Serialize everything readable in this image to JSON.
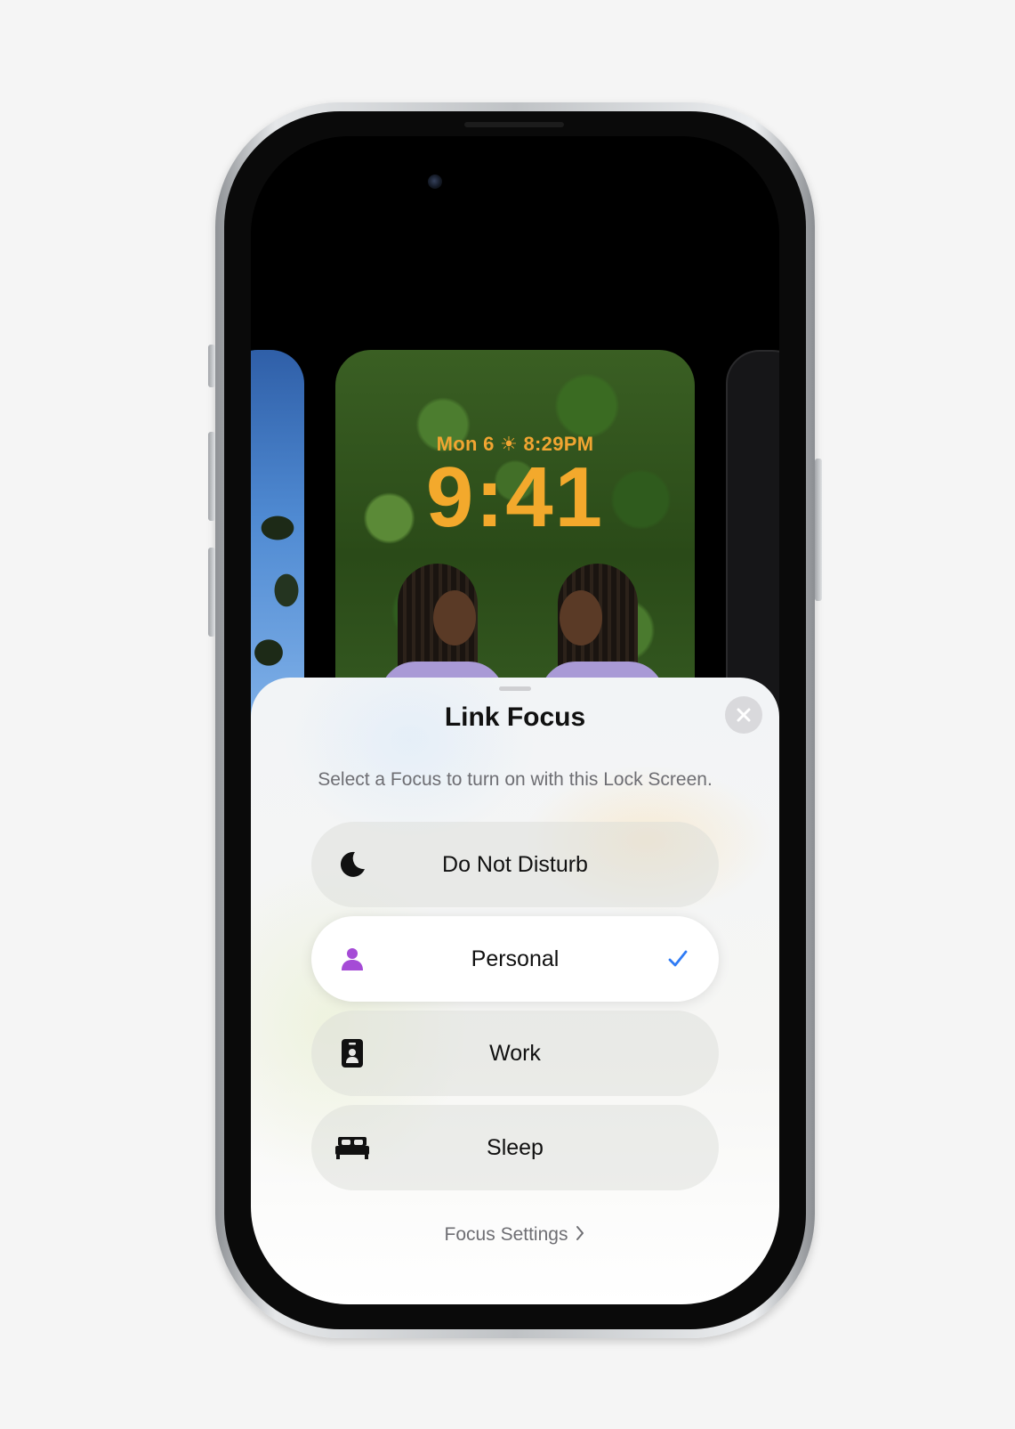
{
  "lock_screen": {
    "date_line": "Mon 6 ☀ 8:29PM",
    "time": "9:41"
  },
  "sheet": {
    "title": "Link Focus",
    "subtitle": "Select a Focus to turn on with this Lock Screen.",
    "options": [
      {
        "label": "Do Not Disturb",
        "icon": "moon-icon",
        "selected": false
      },
      {
        "label": "Personal",
        "icon": "person-icon",
        "selected": true
      },
      {
        "label": "Work",
        "icon": "id-badge-icon",
        "selected": false
      },
      {
        "label": "Sleep",
        "icon": "bed-icon",
        "selected": false
      }
    ],
    "footer_link": "Focus Settings"
  },
  "colors": {
    "accent_check": "#2f7bf5",
    "personal_icon": "#a54bd6",
    "lock_text": "#f3a92c"
  }
}
